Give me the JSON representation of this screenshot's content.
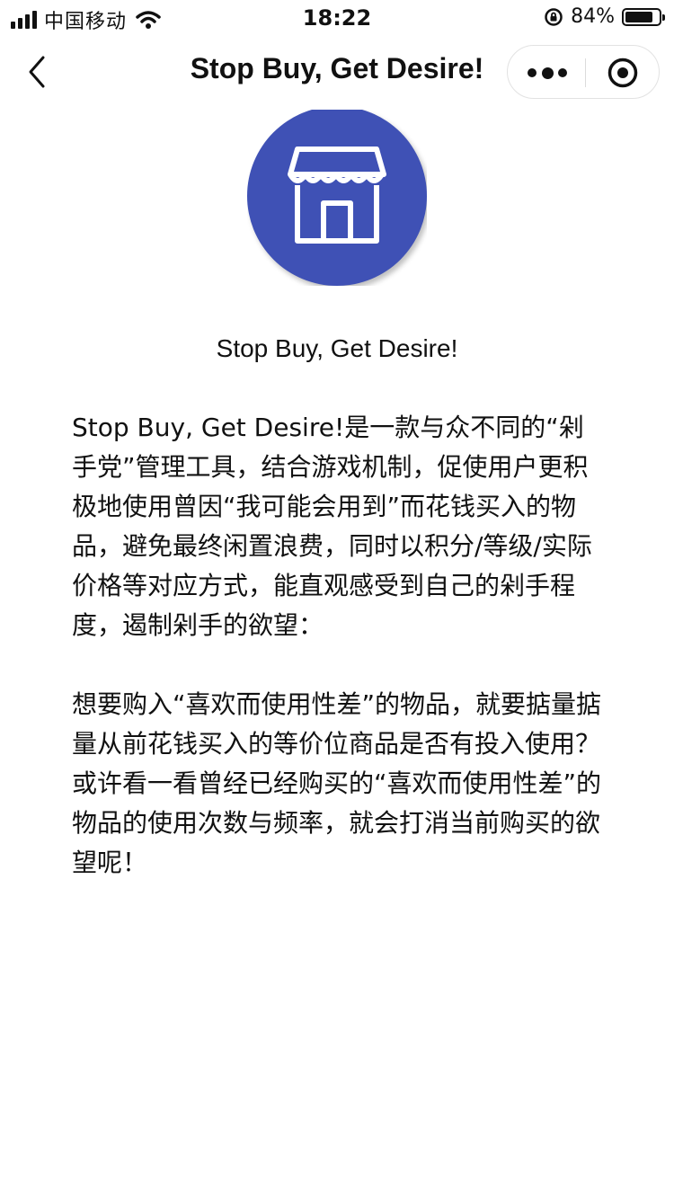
{
  "status_bar": {
    "carrier": "中国移动",
    "time": "18:22",
    "battery_percent": "84%",
    "battery_level": 0.84
  },
  "nav": {
    "title": "Stop Buy, Get Desire!"
  },
  "app": {
    "name": "Stop Buy, Get Desire!",
    "logo_icon": "storefront-icon",
    "brand_color": "#3f51b5"
  },
  "content": {
    "paragraph1": "Stop Buy, Get Desire!是一款与众不同的“剁手党”管理工具，结合游戏机制，促使用户更积极地使用曾因“我可能会用到”而花钱买入的物品，避免最终闲置浪费，同时以积分/等级/实际价格等对应方式，能直观感受到自己的剁手程度，遏制剁手的欲望：",
    "paragraph2": "想要购入“喜欢而使用性差”的物品，就要掂量掂量从前花钱买入的等价位商品是否有投入使用？或许看一看曾经已经购买的“喜欢而使用性差”的物品的使用次数与频率，就会打消当前购买的欲望呢！"
  }
}
